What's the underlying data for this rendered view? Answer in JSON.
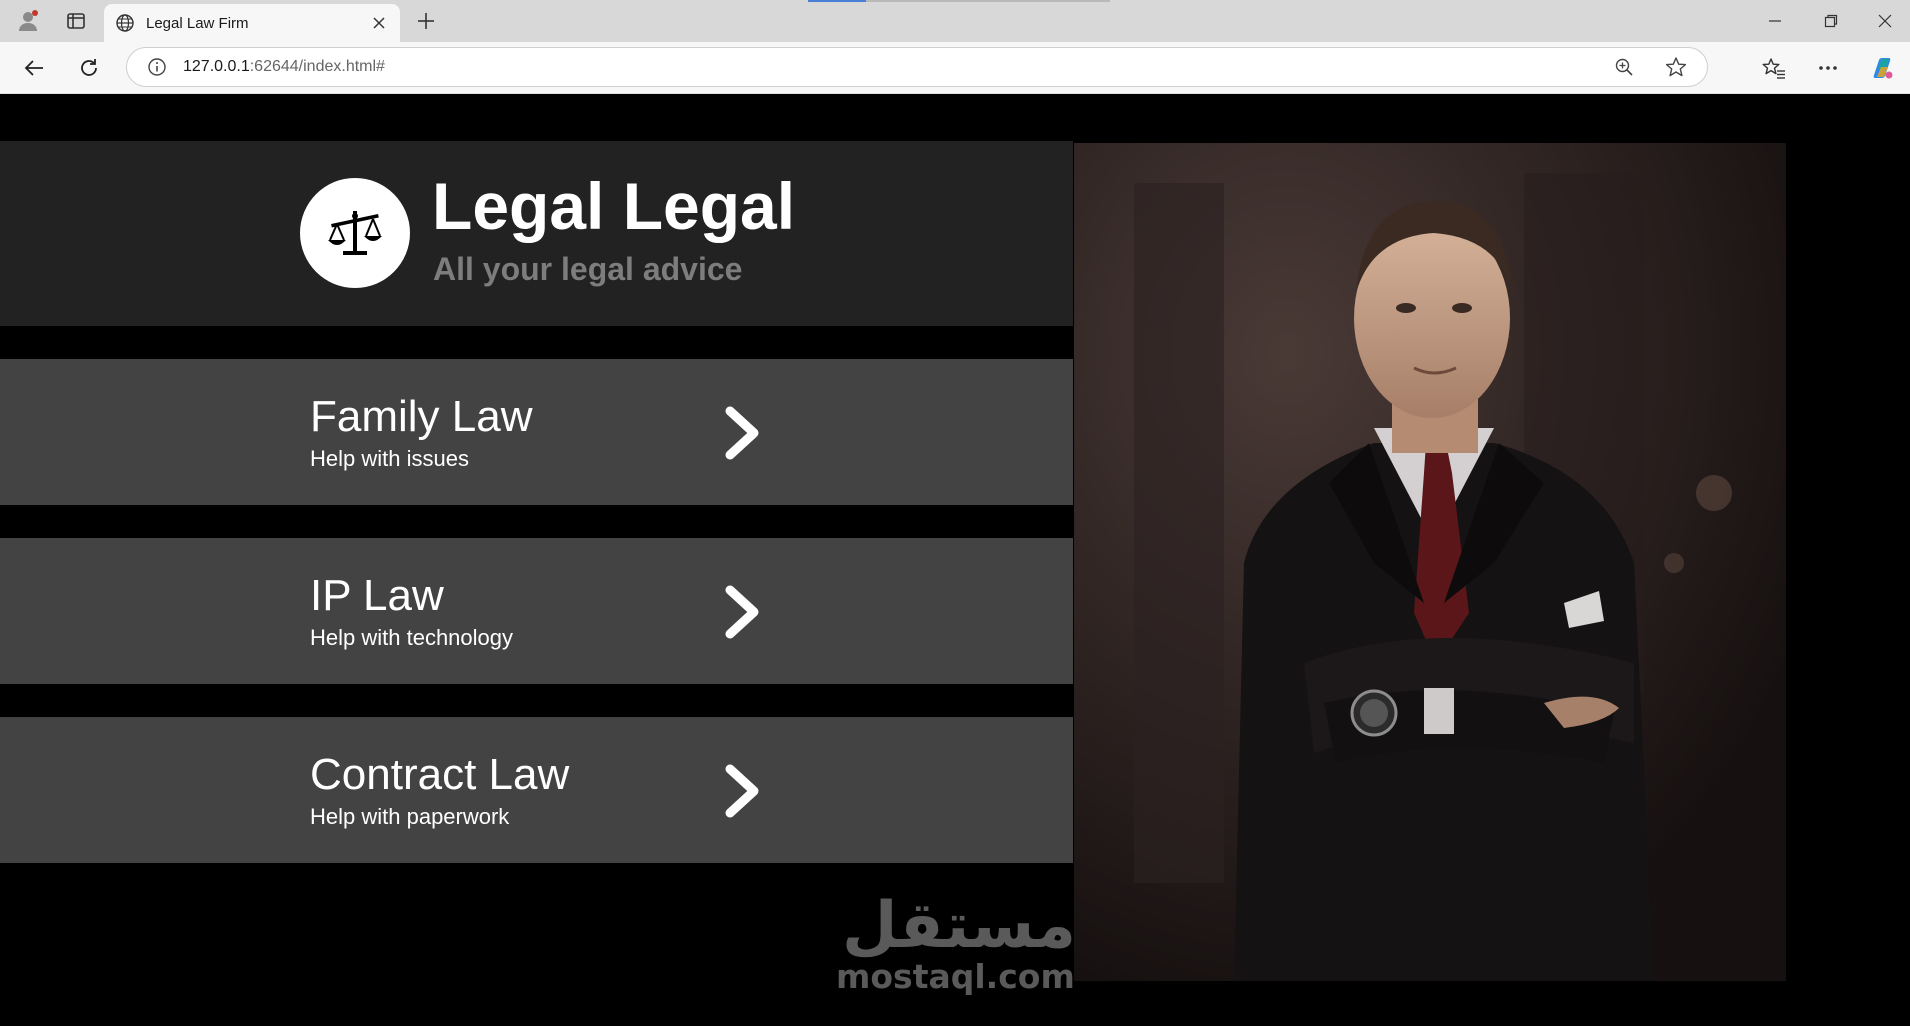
{
  "browser": {
    "tab_title": "Legal Law Firm",
    "url_host": "127.0.0.1",
    "url_rest": ":62644/index.html#",
    "icons": {
      "profile": "profile-icon",
      "workspaces": "workspaces-icon",
      "tab_favicon": "globe-icon",
      "tab_close": "close-icon",
      "new_tab": "plus-icon",
      "minimize": "minimize-icon",
      "restore": "restore-icon",
      "close_window": "close-icon",
      "back": "back-arrow-icon",
      "refresh": "refresh-icon",
      "site_info": "info-icon",
      "zoom": "zoom-icon",
      "favorite": "star-icon",
      "favorites": "favorites-icon",
      "more": "more-icon",
      "copilot": "copilot-icon"
    }
  },
  "header": {
    "title": "Legal Legal",
    "tagline": "All your legal advice",
    "logo_icon": "scales-icon"
  },
  "services": [
    {
      "title": "Family Law",
      "subtitle": "Help with issues"
    },
    {
      "title": "IP Law",
      "subtitle": "Help with technology"
    },
    {
      "title": "Contract Law",
      "subtitle": "Help with paperwork"
    }
  ],
  "watermark": {
    "arabic": "مستقل",
    "latin": "mostaql.com"
  },
  "colors": {
    "page_bg": "#000000",
    "header_bg": "#222222",
    "card_bg": "#434343",
    "tagline": "#7d7d7d",
    "text": "#ffffff"
  }
}
